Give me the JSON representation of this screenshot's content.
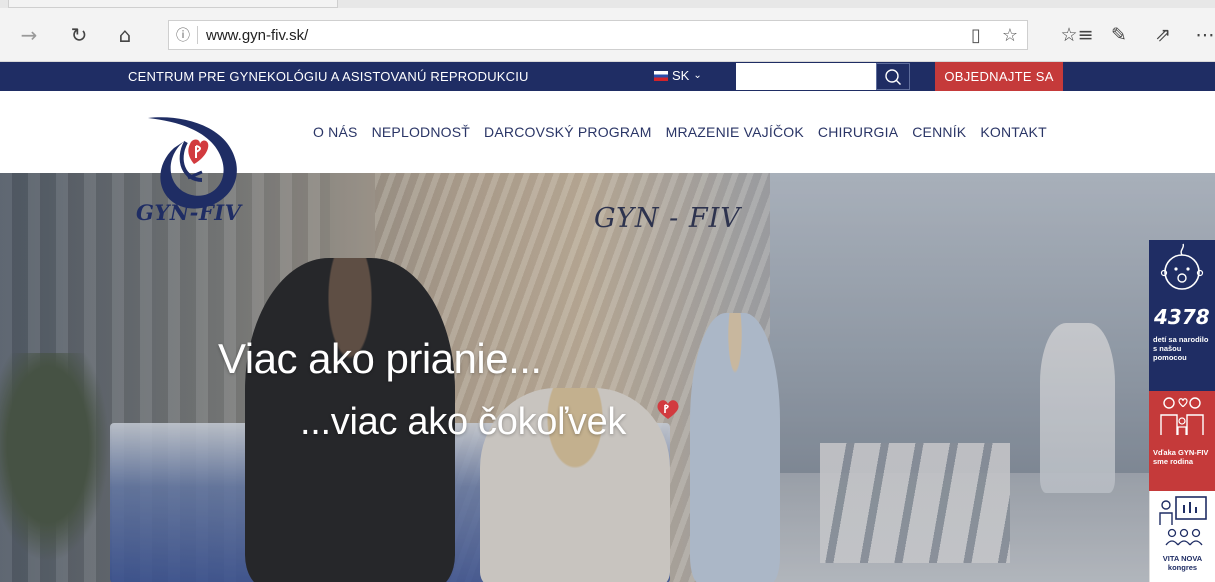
{
  "browser": {
    "url": "www.gyn-fiv.sk/",
    "icons": [
      "forward-icon",
      "refresh-icon",
      "home-icon",
      "info-icon",
      "reading-view-icon",
      "favorite-star-icon",
      "favorites-list-icon",
      "pen-icon",
      "share-icon",
      "more-icon"
    ]
  },
  "topbar": {
    "tagline": "CENTRUM PRE GYNEKOLÓGIU A ASISTOVANÚ REPRODUKCIU",
    "language": "SK",
    "search_value": "",
    "order_label": "OBJEDNAJTE SA"
  },
  "logo": {
    "text": "GYN-FIV"
  },
  "menu": {
    "items": [
      {
        "label": "O NÁS"
      },
      {
        "label": "NEPLODNOSŤ"
      },
      {
        "label": "DARCOVSKÝ PROGRAM"
      },
      {
        "label": "MRAZENIE VAJÍČOK"
      },
      {
        "label": "CHIRURGIA"
      },
      {
        "label": "CENNÍK"
      },
      {
        "label": "KONTAKT"
      }
    ]
  },
  "hero": {
    "wall_logo": "GYN - FIV",
    "line1": "Viac ako prianie...",
    "line2": "...viac ako čokoľvek"
  },
  "widgets": {
    "babies": {
      "count": "4378",
      "text": "detí sa narodilo s našou pomocou"
    },
    "family": {
      "text": "Vďaka GYN-FIV sme rodina"
    },
    "congress": {
      "text": "VITA NOVA kongres"
    }
  },
  "colors": {
    "brand_navy": "#1f2d64",
    "brand_red": "#c53a3a"
  }
}
